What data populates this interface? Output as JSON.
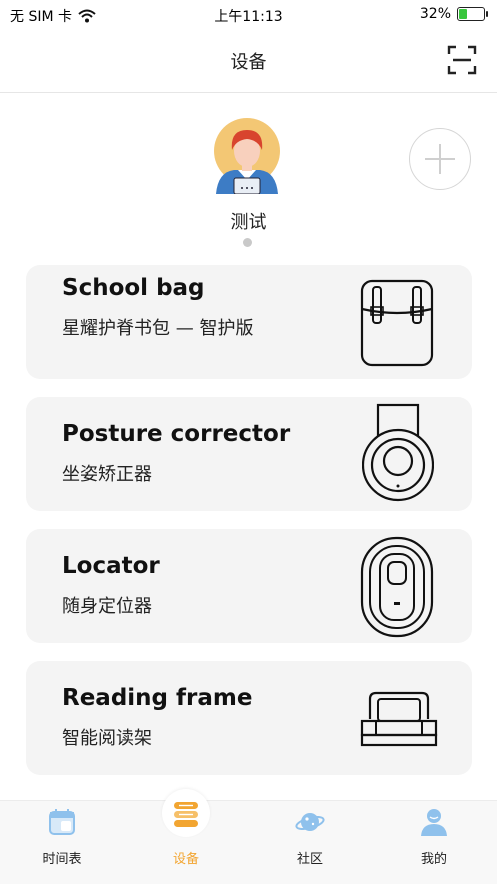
{
  "status": {
    "carrier": "无 SIM 卡",
    "time": "上午11:13",
    "battery_text": "32%",
    "battery_level": 0.32
  },
  "nav": {
    "title": "设备"
  },
  "profile": {
    "name": "测试"
  },
  "devices": [
    {
      "name": "School bag",
      "desc": "星耀护脊书包 — 智护版"
    },
    {
      "name": "Posture corrector",
      "desc": "坐姿矫正器"
    },
    {
      "name": "Locator",
      "desc": "随身定位器"
    },
    {
      "name": "Reading frame",
      "desc": "智能阅读架"
    }
  ],
  "tabs": [
    {
      "label": "时间表",
      "icon": "calendar-icon"
    },
    {
      "label": "设备",
      "icon": "device-stack-icon"
    },
    {
      "label": "社区",
      "icon": "planet-icon"
    },
    {
      "label": "我的",
      "icon": "person-icon"
    }
  ],
  "colors": {
    "accent": "#f2a531",
    "card_bg": "#f4f4f4",
    "tab_icon_blue": "#8fc1ec"
  }
}
